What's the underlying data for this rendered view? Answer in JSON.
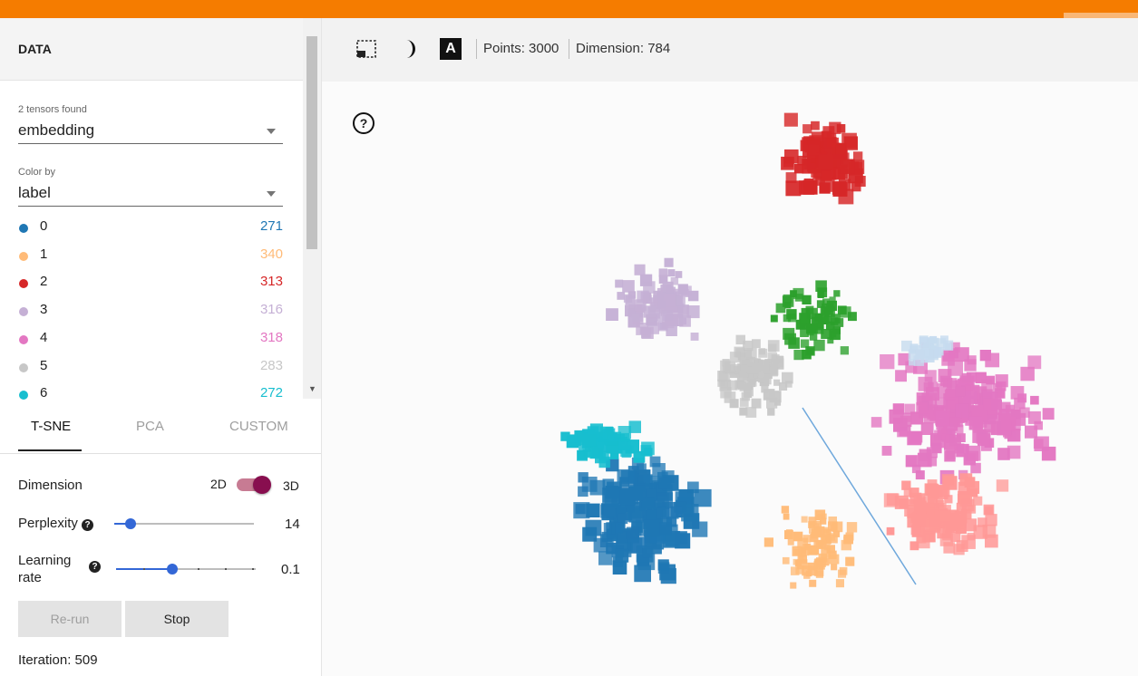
{
  "data_panel": {
    "title": "DATA",
    "tensors_caption": "2 tensors found",
    "tensor_value": "embedding",
    "color_by_caption": "Color by",
    "color_by_value": "label",
    "labels": [
      {
        "label": "0",
        "count": "271",
        "color": "#1f77b4"
      },
      {
        "label": "1",
        "count": "340",
        "color": "#ffbb78"
      },
      {
        "label": "2",
        "count": "313",
        "color": "#d62728"
      },
      {
        "label": "3",
        "count": "316",
        "color": "#c5b0d5"
      },
      {
        "label": "4",
        "count": "318",
        "color": "#e377c2"
      },
      {
        "label": "5",
        "count": "283",
        "color": "#c7c7c7"
      },
      {
        "label": "6",
        "count": "272",
        "color": "#17becf"
      }
    ]
  },
  "projection": {
    "tabs": [
      "T-SNE",
      "PCA",
      "CUSTOM"
    ],
    "dimension_label": "Dimension",
    "dim_2d": "2D",
    "dim_3d": "3D",
    "perplexity_label": "Perplexity",
    "perplexity_value": "14",
    "learning_rate_label": "Learning rate",
    "learning_rate_value": "0.1",
    "rerun_label": "Re-run",
    "stop_label": "Stop",
    "iteration_text": "Iteration: 509"
  },
  "toolbar": {
    "points_text": "Points: 3000",
    "dimension_text": "Dimension: 784",
    "label_icon_text": "A"
  },
  "help_glyph": "?"
}
